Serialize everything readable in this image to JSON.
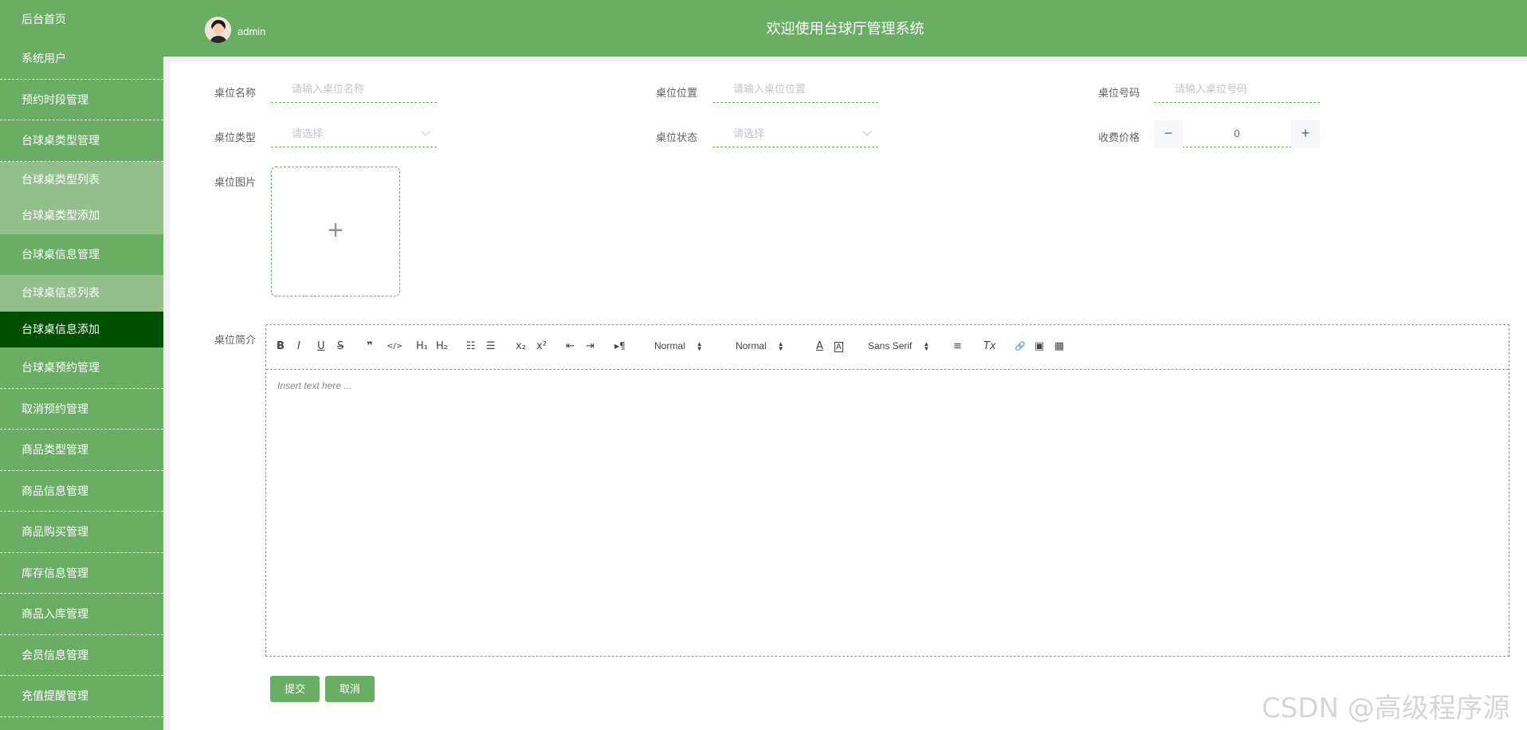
{
  "app": {
    "title": "欢迎使用台球厅管理系统",
    "user": "admin"
  },
  "sidebar": {
    "items": [
      {
        "label": "后台首页"
      },
      {
        "label": "系统用户"
      },
      {
        "label": "预约时段管理"
      },
      {
        "label": "台球桌类型管理"
      },
      {
        "label": "台球桌类型列表"
      },
      {
        "label": "台球桌类型添加"
      },
      {
        "label": "台球桌信息管理"
      },
      {
        "label": "台球桌信息列表"
      },
      {
        "label": "台球桌信息添加"
      },
      {
        "label": "台球桌预约管理"
      },
      {
        "label": "取消预约管理"
      },
      {
        "label": "商品类型管理"
      },
      {
        "label": "商品信息管理"
      },
      {
        "label": "商品购买管理"
      },
      {
        "label": "库存信息管理"
      },
      {
        "label": "商品入库管理"
      },
      {
        "label": "会员信息管理"
      },
      {
        "label": "充值提醒管理"
      }
    ],
    "active": "台球桌信息添加"
  },
  "form": {
    "name": {
      "label": "桌位名称",
      "placeholder": "请输入桌位名称"
    },
    "location": {
      "label": "桌位位置",
      "placeholder": "请输入桌位位置"
    },
    "number": {
      "label": "桌位号码",
      "placeholder": "请输入桌位号码"
    },
    "type": {
      "label": "桌位类型",
      "placeholder": "请选择"
    },
    "status": {
      "label": "桌位状态",
      "placeholder": "请选择"
    },
    "price": {
      "label": "收费价格",
      "value": "0",
      "minus": "−",
      "plus": "+"
    },
    "image": {
      "label": "桌位图片",
      "plus": "+"
    },
    "intro": {
      "label": "桌位简介"
    }
  },
  "editor": {
    "toolbar": {
      "bold": "B",
      "italic": "I",
      "underline": "U",
      "strike": "S",
      "blockquote": "❞",
      "code": "</>",
      "h1": "H₁",
      "h2": "H₂",
      "ordered_list": "☷",
      "bullet_list": "☰",
      "subscript": "x₂",
      "superscript": "x²",
      "outdent": "⇤",
      "indent": "⇥",
      "direction": "▸¶",
      "size_select": "Normal",
      "header_select": "Normal",
      "color": "A",
      "background": "A",
      "font_select": "Sans Serif",
      "align": "≡",
      "clean": "Tx",
      "link": "🔗",
      "image": "▣",
      "video": "▦"
    },
    "placeholder": "Insert text here ..."
  },
  "buttons": {
    "submit": "提交",
    "cancel": "取消"
  },
  "watermark": "CSDN @高级程序源"
}
